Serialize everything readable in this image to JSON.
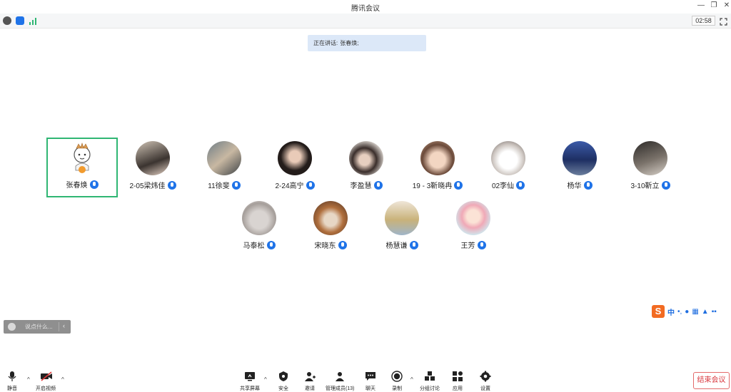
{
  "window": {
    "title": "腾讯会议",
    "controls": [
      "minimize-icon",
      "restore-icon",
      "close-icon"
    ]
  },
  "status": {
    "timer": "02:58",
    "icons": [
      "info-icon",
      "shield-icon",
      "signal-icon"
    ]
  },
  "speaking": {
    "label": "正在讲话:",
    "name": "张春焕;"
  },
  "participants": [
    {
      "name": "张春焕",
      "active": true,
      "avatar": "cartoon"
    },
    {
      "name": "2-05梁炜佳",
      "avatar": "photo"
    },
    {
      "name": "11徐斐",
      "avatar": "photo"
    },
    {
      "name": "2-24高宁",
      "avatar": "photo"
    },
    {
      "name": "李盈慧",
      "avatar": "photo"
    },
    {
      "name": "19 - 3靳晓冉",
      "avatar": "photo"
    },
    {
      "name": "02李仙",
      "avatar": "photo"
    },
    {
      "name": "杨华",
      "avatar": "photo"
    },
    {
      "name": "3-10靳立",
      "avatar": "photo"
    },
    {
      "name": "马泰松",
      "avatar": "photo"
    },
    {
      "name": "宋晓东",
      "avatar": "photo"
    },
    {
      "name": "杨慧谦",
      "avatar": "photo"
    },
    {
      "name": "王芳",
      "avatar": "photo"
    }
  ],
  "chat": {
    "placeholder": "说点什么..."
  },
  "ime": {
    "label": "中"
  },
  "toolbar": {
    "mute": "静音",
    "video": "开启视频",
    "share": "共享屏幕",
    "security": "安全",
    "invite": "邀请",
    "members": "管理成员(13)",
    "chat": "聊天",
    "record": "录制",
    "breakout": "分组讨论",
    "apps": "应用",
    "settings": "设置",
    "end": "结束会议"
  },
  "colors": {
    "accent": "#1f73e8",
    "active_border": "#2fb673",
    "end": "#d9393f"
  }
}
